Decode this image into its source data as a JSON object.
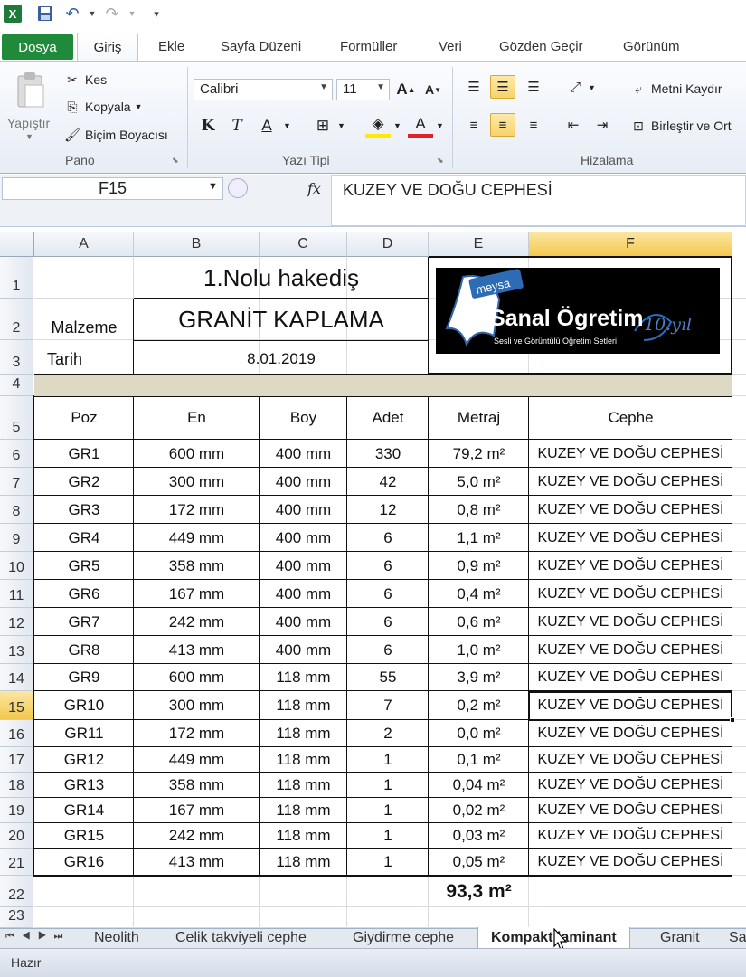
{
  "app": {
    "icon": "excel-icon"
  },
  "qat": {
    "icons": [
      "save-icon",
      "undo-icon",
      "redo-icon",
      "customize-icon"
    ]
  },
  "tabs": {
    "dosya": "Dosya",
    "items": [
      {
        "label": "Giriş"
      },
      {
        "label": "Ekle"
      },
      {
        "label": "Sayfa Düzeni"
      },
      {
        "label": "Formüller"
      },
      {
        "label": "Veri"
      },
      {
        "label": "Gözden Geçir"
      },
      {
        "label": "Görünüm"
      }
    ]
  },
  "ribbon": {
    "pano": {
      "label": "Pano",
      "paste": "Yapıştır",
      "cut": "Kes",
      "copy": "Kopyala",
      "painter": "Biçim Boyacısı"
    },
    "font": {
      "label": "Yazı Tipi",
      "name": "Calibri",
      "size": "11"
    },
    "align": {
      "label": "Hizalama",
      "wrap": "Metni Kaydır",
      "merge": "Birleştir ve Ort"
    }
  },
  "formula_bar": {
    "name_box": "F15",
    "fx": "fx",
    "content": "KUZEY VE DOĞU CEPHESİ"
  },
  "columns": [
    "A",
    "B",
    "C",
    "D",
    "E",
    "F"
  ],
  "rows": [
    "1",
    "2",
    "3",
    "4",
    "5",
    "6",
    "7",
    "8",
    "9",
    "10",
    "11",
    "12",
    "13",
    "14",
    "15",
    "16",
    "17",
    "18",
    "19",
    "20",
    "21",
    "22",
    "23"
  ],
  "sheet": {
    "title": "1.Nolu hakediş",
    "malzeme_label": "Malzeme",
    "malzeme_value": "GRANİT KAPLAMA",
    "tarih_label": "Tarih",
    "tarih_value": "8.01.2019",
    "logo": {
      "brand": "meysa",
      "title": "Sanal Ögretim",
      "subtitle": "Sesli ve Görüntülü Öğretim Setleri",
      "badge": "10.yıl"
    },
    "headers": [
      "Poz",
      "En",
      "Boy",
      "Adet",
      "Metraj",
      "Cephe"
    ],
    "data": [
      [
        "GR1",
        "600 mm",
        "400 mm",
        "330",
        "79,2 m²",
        "KUZEY VE DOĞU CEPHESİ"
      ],
      [
        "GR2",
        "300 mm",
        "400 mm",
        "42",
        "5,0 m²",
        "KUZEY VE DOĞU CEPHESİ"
      ],
      [
        "GR3",
        "172 mm",
        "400 mm",
        "12",
        "0,8 m²",
        "KUZEY VE DOĞU CEPHESİ"
      ],
      [
        "GR4",
        "449 mm",
        "400 mm",
        "6",
        "1,1 m²",
        "KUZEY VE DOĞU CEPHESİ"
      ],
      [
        "GR5",
        "358 mm",
        "400 mm",
        "6",
        "0,9 m²",
        "KUZEY VE DOĞU CEPHESİ"
      ],
      [
        "GR6",
        "167 mm",
        "400 mm",
        "6",
        "0,4 m²",
        "KUZEY VE DOĞU CEPHESİ"
      ],
      [
        "GR7",
        "242 mm",
        "400 mm",
        "6",
        "0,6 m²",
        "KUZEY VE DOĞU CEPHESİ"
      ],
      [
        "GR8",
        "413 mm",
        "400 mm",
        "6",
        "1,0 m²",
        "KUZEY VE DOĞU CEPHESİ"
      ],
      [
        "GR9",
        "600 mm",
        "118 mm",
        "55",
        "3,9 m²",
        "KUZEY VE DOĞU CEPHESİ"
      ],
      [
        "GR10",
        "300 mm",
        "118 mm",
        "7",
        "0,2 m²",
        "KUZEY VE DOĞU CEPHESİ"
      ],
      [
        "GR11",
        "172 mm",
        "118 mm",
        "2",
        "0,0 m²",
        "KUZEY VE DOĞU CEPHESİ"
      ],
      [
        "GR12",
        "449 mm",
        "118 mm",
        "1",
        "0,1 m²",
        "KUZEY VE DOĞU CEPHESİ"
      ],
      [
        "GR13",
        "358 mm",
        "118 mm",
        "1",
        "0,04 m²",
        "KUZEY VE DOĞU CEPHESİ"
      ],
      [
        "GR14",
        "167 mm",
        "118 mm",
        "1",
        "0,02 m²",
        "KUZEY VE DOĞU CEPHESİ"
      ],
      [
        "GR15",
        "242 mm",
        "118 mm",
        "1",
        "0,03 m²",
        "KUZEY VE DOĞU CEPHESİ"
      ],
      [
        "GR16",
        "413 mm",
        "118 mm",
        "1",
        "0,05 m²",
        "KUZEY VE DOĞU CEPHESİ"
      ]
    ],
    "total": "93,3 m²"
  },
  "sheet_tabs": [
    "Neolith",
    "Celik takviyeli cephe",
    "Giydirme cephe",
    "Kompakt laminant",
    "Granit",
    "Sa"
  ],
  "active_sheet": "Kompakt laminant",
  "status": {
    "text": "Hazır"
  },
  "colors": {
    "accent": "#1f8a3a",
    "selection": "#f3c84e",
    "row4_fill": "#ddd9c4"
  }
}
